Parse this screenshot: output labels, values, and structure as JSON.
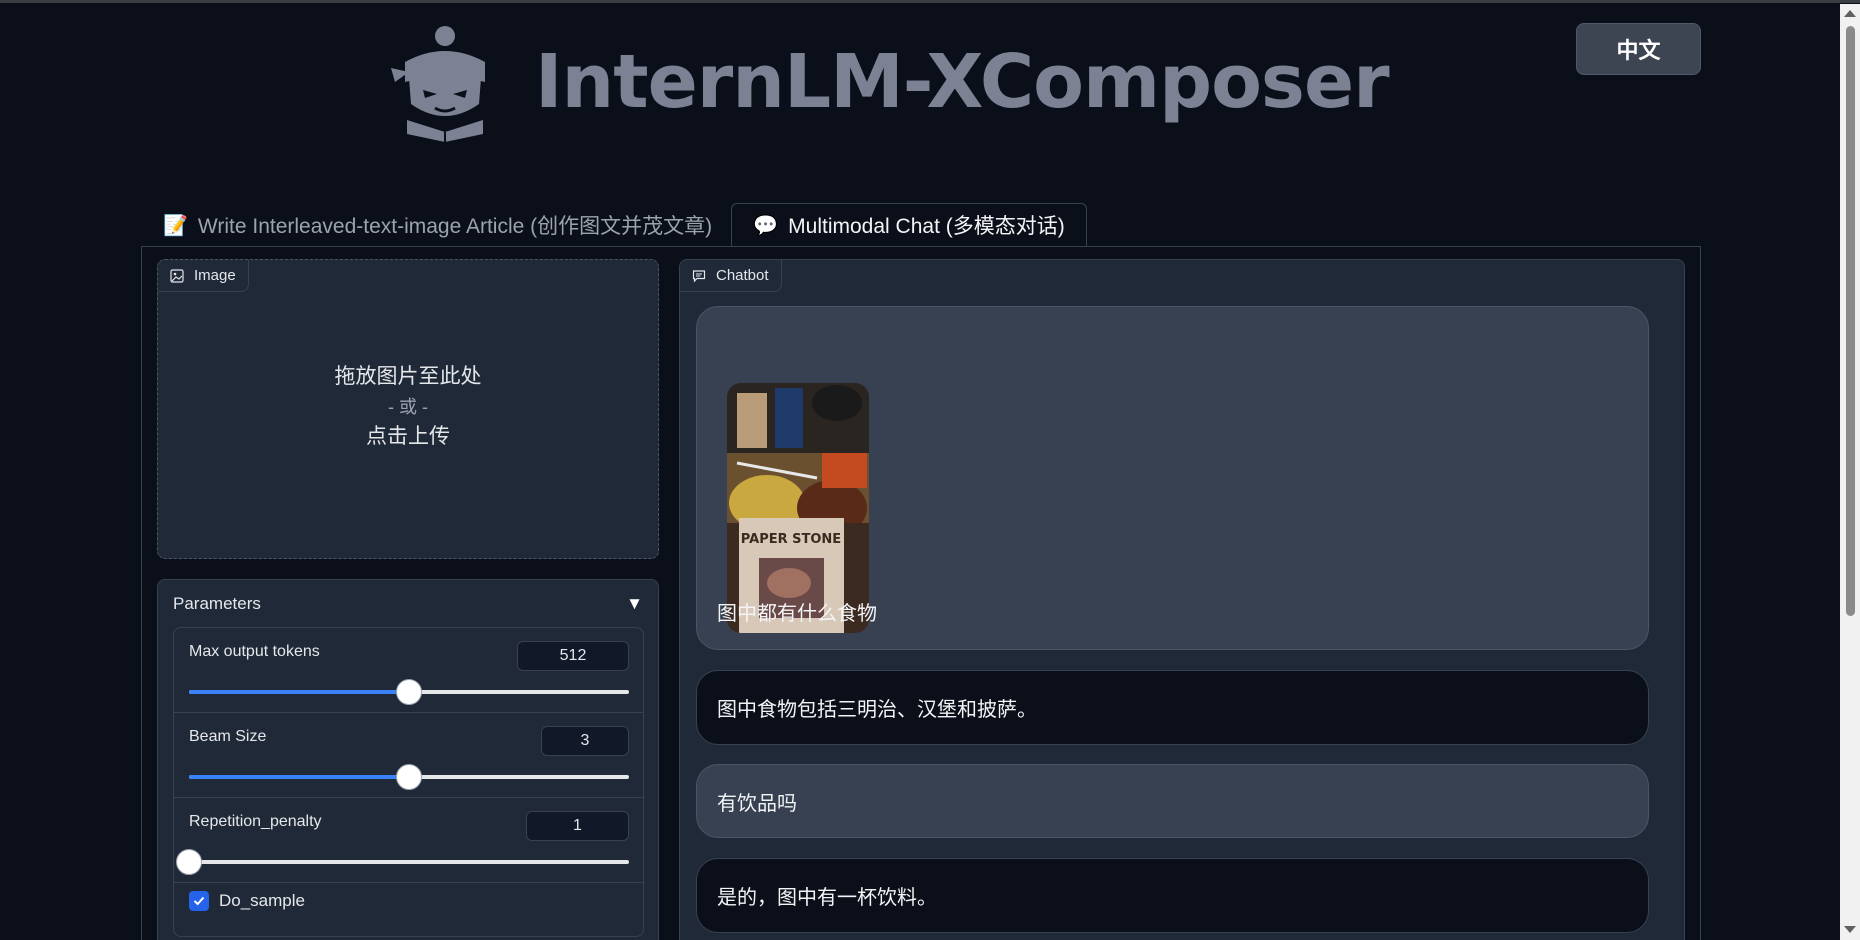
{
  "header": {
    "title": "InternLM-XComposer",
    "lang_button": "中文"
  },
  "tabs": [
    {
      "icon": "📝",
      "label": "Write Interleaved-text-image Article (创作图文并茂文章)"
    },
    {
      "icon": "💬",
      "label": "Multimodal Chat (多模态对话)"
    }
  ],
  "image_upload": {
    "label": "Image",
    "line1": "拖放图片至此处",
    "line2": "- 或 -",
    "line3": "点击上传"
  },
  "parameters": {
    "title": "Parameters",
    "max_tokens": {
      "label": "Max output tokens",
      "value": "512",
      "fraction": 0.5
    },
    "beam_size": {
      "label": "Beam Size",
      "value": "3",
      "fraction": 0.5
    },
    "repetition": {
      "label": "Repetition_penalty",
      "value": "1",
      "fraction": 0.0
    },
    "do_sample": {
      "label": "Do_sample",
      "checked": true
    }
  },
  "chatbot": {
    "label": "Chatbot",
    "image_text": "PAPER STONE",
    "messages": [
      {
        "role": "user",
        "text": "图中都有什么食物"
      },
      {
        "role": "bot",
        "text": "图中食物包括三明治、汉堡和披萨。"
      },
      {
        "role": "user",
        "text": "有饮品吗"
      },
      {
        "role": "bot",
        "text": "是的，图中有一杯饮料。"
      }
    ]
  },
  "colors": {
    "background": "#0b0f19",
    "panel": "#1f2937",
    "accent": "#3b82f6"
  }
}
